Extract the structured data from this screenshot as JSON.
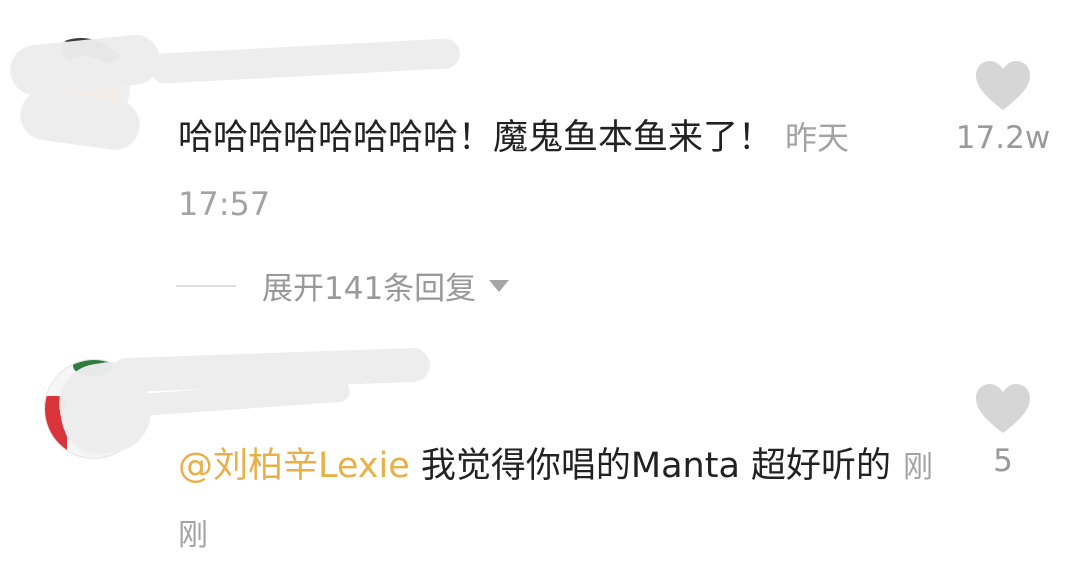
{
  "comments": [
    {
      "username": "",
      "text": "哈哈哈哈哈哈哈哈！魔鬼鱼本鱼来了！",
      "time": "昨天17:57",
      "likes": "17.2w",
      "expand_replies": "展开141条回复"
    },
    {
      "username": "",
      "mention": "@刘柏辛Lexie",
      "text": " 我觉得你唱的Manta 超好听的",
      "time": "刚刚",
      "likes": "5"
    }
  ],
  "icons": {
    "like": "heart-icon",
    "expand": "triangle-down-icon"
  },
  "colors": {
    "mention": "#e9b04a",
    "text": "#222222",
    "secondary": "#9a9a9a",
    "heart": "#d6d6d6"
  }
}
